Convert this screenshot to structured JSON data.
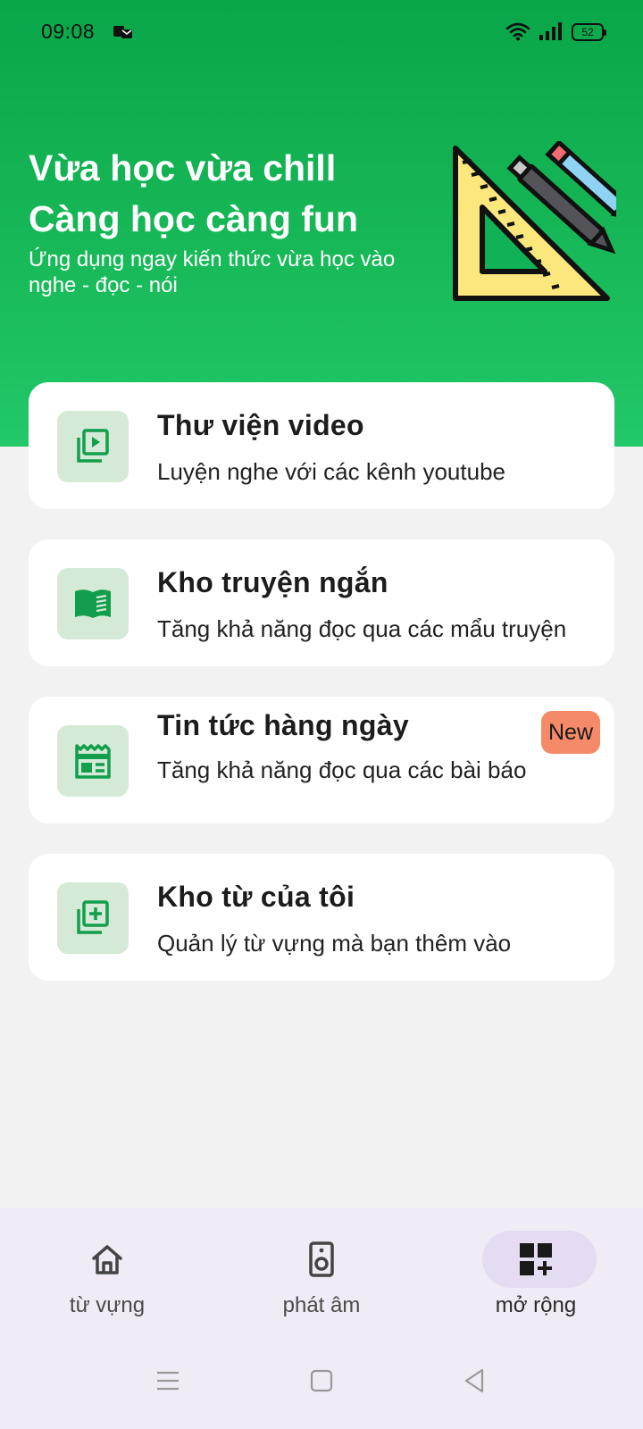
{
  "status_bar": {
    "time": "09:08",
    "battery": "52",
    "icons": [
      "notification-icon",
      "wifi-icon",
      "signal-icon",
      "battery-icon"
    ]
  },
  "hero": {
    "title_line1": "Vừa học vừa chill",
    "title_line2": "Càng học càng fun",
    "subtitle": "Ứng dụng ngay kiến thức vừa học vào nghe - đọc - nói",
    "illustration": "ruler-pens-illustration"
  },
  "features": [
    {
      "title": "Thư viện video",
      "description": "Luyện nghe với các kênh youtube",
      "icon": "video-library-icon"
    },
    {
      "title": "Kho truyện ngắn",
      "description": "Tăng khả năng đọc qua các mẩu truyện",
      "icon": "book-icon"
    },
    {
      "title": "Tin tức hàng ngày",
      "description": "Tăng khả năng đọc qua các bài báo",
      "icon": "newspaper-icon",
      "badge": "New"
    },
    {
      "title": "Kho từ của tôi",
      "description": "Quản lý từ vựng mà bạn thêm vào",
      "icon": "add-library-icon"
    }
  ],
  "bottom_nav": {
    "items": [
      {
        "label": "từ vựng",
        "icon": "home-icon",
        "selected": false
      },
      {
        "label": "phát âm",
        "icon": "speaker-icon",
        "selected": false
      },
      {
        "label": "mở rộng",
        "icon": "grid-add-icon",
        "selected": true
      }
    ]
  },
  "colors": {
    "hero_top": "#0aa64a",
    "hero_bottom": "#22c86a",
    "icon_green": "#129e4c",
    "icon_bg": "#d4ead7",
    "badge": "#f58a68",
    "nav_bg": "#f1ebf5",
    "nav_selected": "#e5dcf1"
  }
}
